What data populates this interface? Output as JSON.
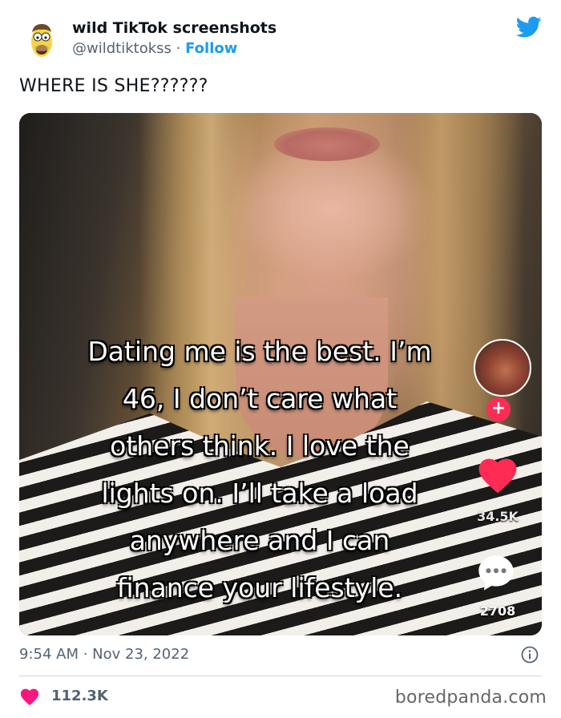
{
  "tweet": {
    "author_name": "wild TikTok screenshots",
    "author_handle": "@wildtiktokss",
    "separator": "·",
    "follow_label": "Follow",
    "text": "WHERE IS SHE??????",
    "timestamp": "9:54 AM · Nov 23, 2022",
    "likes": "112.3K"
  },
  "tiktok": {
    "caption_lines": [
      "Dating me is the best. I’m",
      "46, I don’t care what",
      "others think. I love the",
      "lights on. I’ll take a load",
      "anywhere and I can",
      "finance your lifestyle."
    ],
    "like_count": "34.5K",
    "comment_count": "2708",
    "follow_plus": "+"
  },
  "watermark": "boredpanda.com",
  "colors": {
    "twitter_blue": "#1d9bf0",
    "like_pink": "#f91880",
    "tiktok_red": "#fe2c55",
    "text_gray": "#536471"
  },
  "icons": {
    "twitter": "twitter-bird-icon",
    "info": "info-icon",
    "heart": "heart-icon",
    "tiktok_heart": "tiktok-heart-icon",
    "tiktok_comment": "comment-bubble-icon"
  }
}
